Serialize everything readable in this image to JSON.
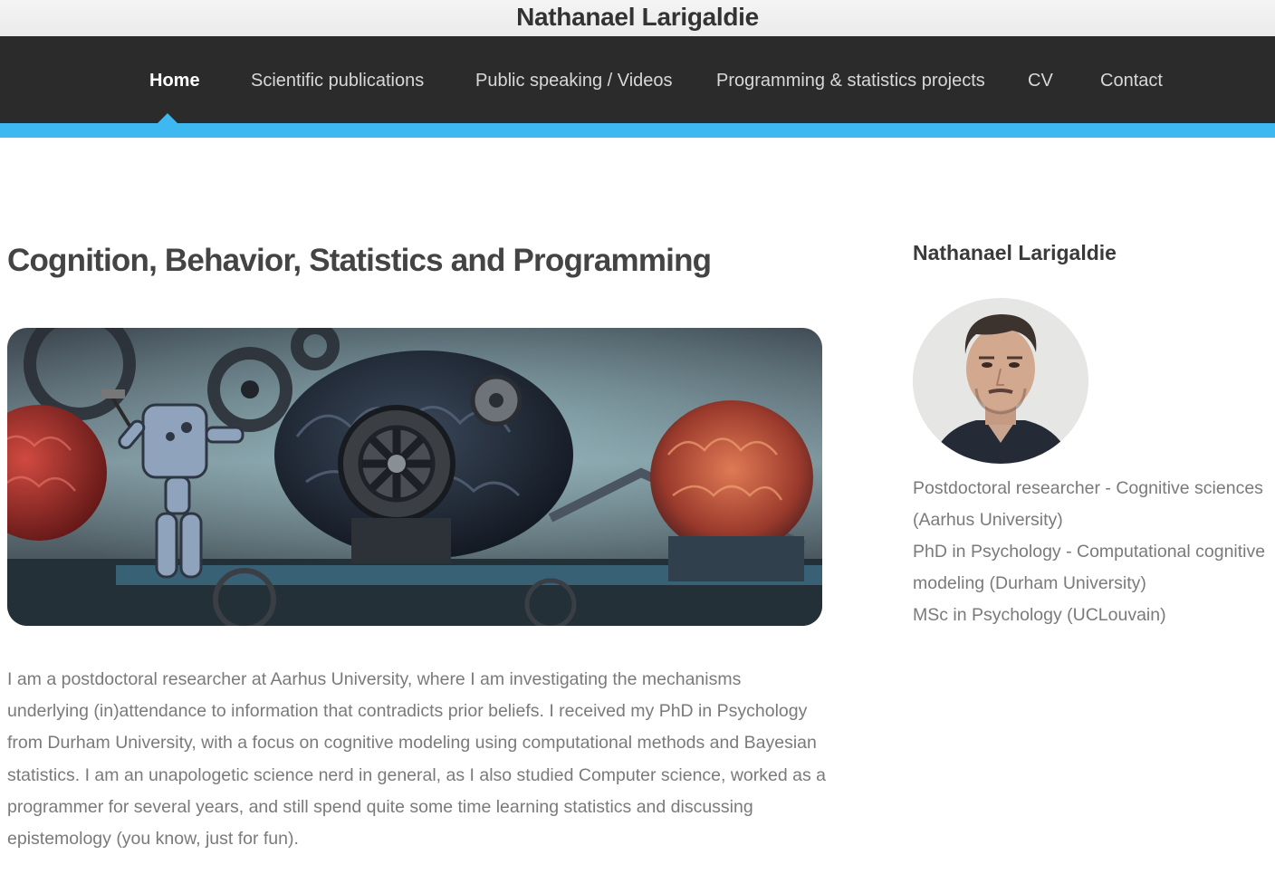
{
  "site": {
    "title": "Nathanael Larigaldie"
  },
  "nav": {
    "items": [
      {
        "label": "Home",
        "active": true
      },
      {
        "label": "Scientific publications"
      },
      {
        "label": "Public speaking / Videos"
      },
      {
        "label": "Programming & statistics projects"
      },
      {
        "label": "CV"
      },
      {
        "label": "Contact"
      }
    ]
  },
  "main": {
    "heading": "Cognition, Behavior, Statistics and Programming",
    "intro": "I am a postdoctoral researcher at Aarhus University, where I am investigating the mechanisms underlying (in)attendance to information that contradicts prior beliefs. I received my PhD in Psychology from Durham University, with a focus on cognitive modeling using computational methods and Bayesian statistics. I am an unapologetic science nerd in general, as I also studied Computer science, worked as a programmer for several years, and still spend quite some time learning statistics and discussing epistemology (you know, just for fun)."
  },
  "sidebar": {
    "name": "Nathanael Larigaldie",
    "credentials": [
      "Postdoctoral researcher - Cognitive sciences (Aarhus University)",
      "PhD in Psychology - Computational cognitive modeling (Durham University)",
      "MSc in Psychology (UCLouvain)"
    ]
  },
  "colors": {
    "navbar": "#2b2b2b",
    "accent": "#3db8f0",
    "heading": "#444444",
    "body_text": "#7a7a7a"
  }
}
